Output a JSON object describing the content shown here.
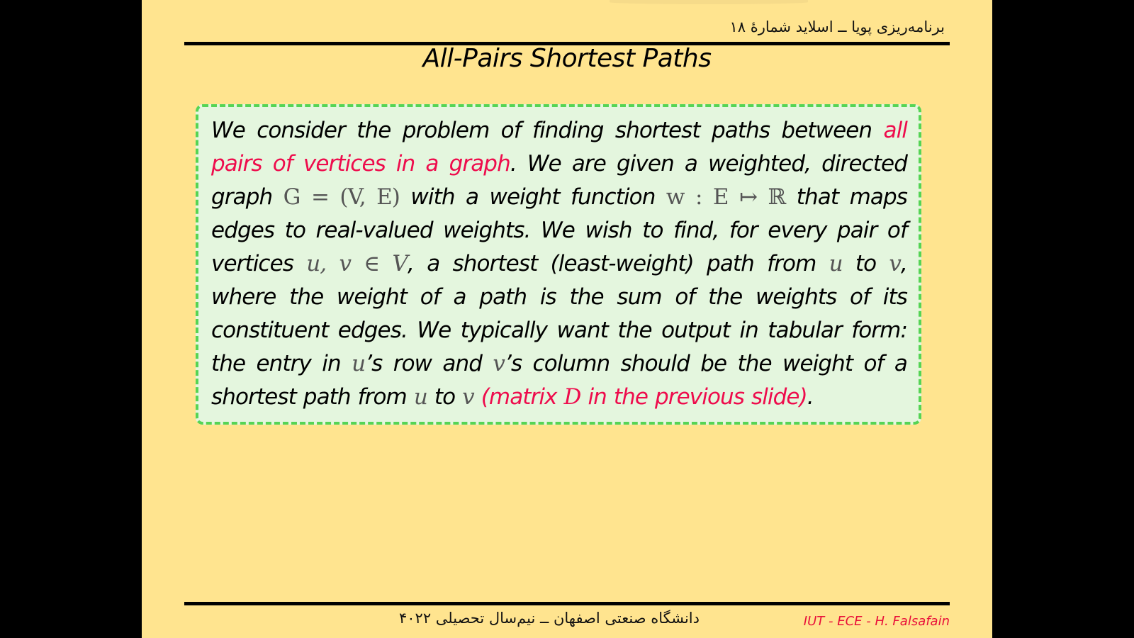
{
  "header": {
    "title_fa": "برنامه‌ریزی پویا ــ اسلاید شمارهٔ ۱۸"
  },
  "slide": {
    "title": "All-Pairs Shortest Paths",
    "paragraph": {
      "s01": "We consider the problem of finding shortest paths between ",
      "s02": "all pairs of vertices in a graph",
      "s03": ". We are given a weighted, directed graph ",
      "m01": "G = (V, E)",
      "s04": " with a weight function ",
      "m02": "w : E ↦ ℝ",
      "s05": " that maps edges to real-valued weights. We wish to find, for every pair of vertices ",
      "m03": "u, v ∈ V",
      "s06": ", a shortest (least-weight) path from ",
      "m04": "u",
      "s07": " to ",
      "m05": "v",
      "s08": ", where the weight of a path is the sum of the weights of its constituent edges. We typically want the output in tabular form: the entry in ",
      "m06": "u",
      "s09": "’s row and ",
      "m07": "v",
      "s10": "’s column should be the weight of a shortest path from ",
      "m08": "u",
      "s11": " to ",
      "m09": "v",
      "s12": " ",
      "s13": "(matrix ",
      "m10": "D",
      "s14": " in the previous slide)",
      "s15": "."
    }
  },
  "footer": {
    "university_fa": "دانشگاه صنعتی اصفهان ــ نیم‌سال تحصیلی ۴۰۲۲",
    "credit": "IUT - ECE - H. Falsafain"
  },
  "colors": {
    "background": "#ffe48f",
    "highlight": "#ee0c4c",
    "box_fill": "#e4f6de",
    "box_border": "#55d455"
  }
}
